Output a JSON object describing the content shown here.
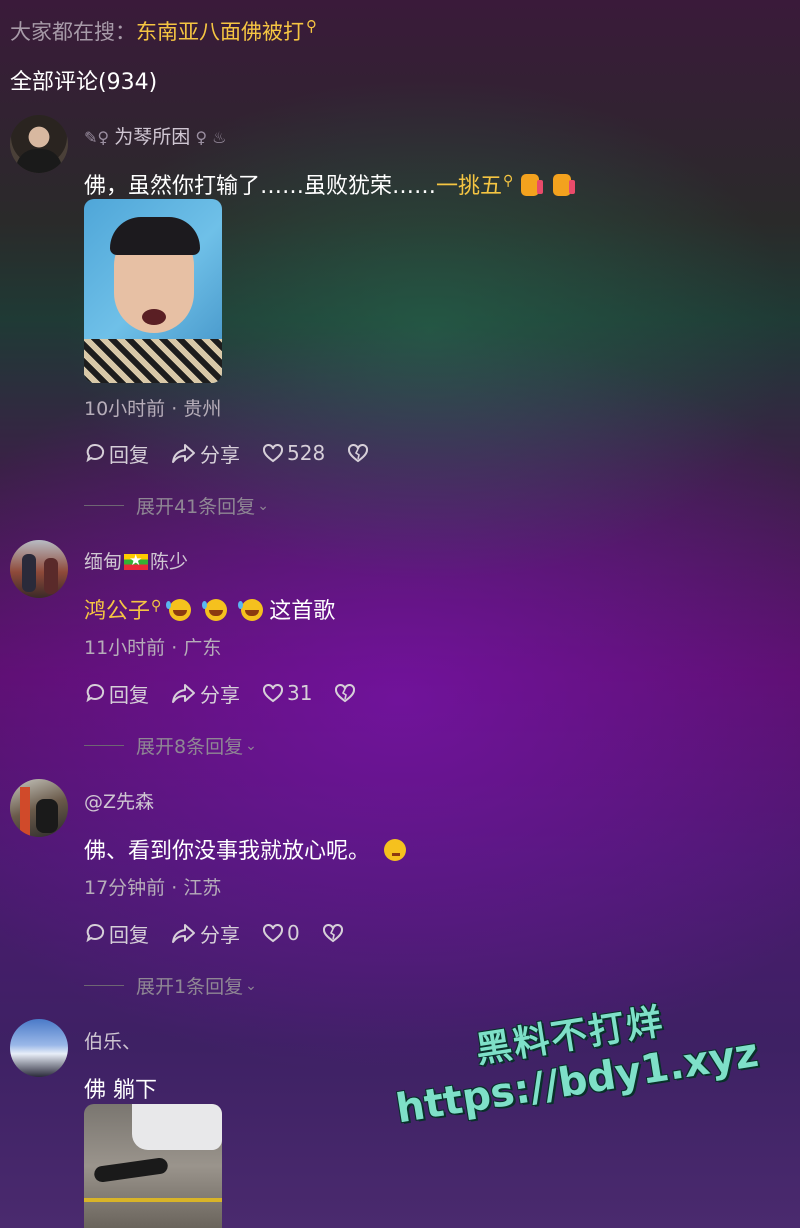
{
  "search_hint": {
    "label": "大家都在搜：",
    "keyword": "东南亚八面佛被打"
  },
  "comments_title": "全部评论(934)",
  "comments": [
    {
      "username": "为琴所困",
      "text": "佛，虽然你打输了……虽败犹荣……",
      "link_text": "一挑五",
      "emojis": [
        "thumbs-up",
        "thumbs-up"
      ],
      "time": "10小时前",
      "location": "贵州",
      "reply_label": "回复",
      "share_label": "分享",
      "likes": "528",
      "expand_label": "展开41条回复"
    },
    {
      "username_prefix": "缅甸",
      "username": "陈少",
      "link_text": "鸿公子",
      "emojis": [
        "laughing",
        "laughing",
        "laughing"
      ],
      "text": "这首歌",
      "time": "11小时前",
      "location": "广东",
      "reply_label": "回复",
      "share_label": "分享",
      "likes": "31",
      "expand_label": "展开8条回复"
    },
    {
      "username": "@Z先森",
      "text": "佛、看到你没事我就放心呢。",
      "emojis": [
        "thinking"
      ],
      "time": "17分钟前",
      "location": "江苏",
      "reply_label": "回复",
      "share_label": "分享",
      "likes": "0",
      "expand_label": "展开1条回复"
    },
    {
      "username": "伯乐、",
      "text": "佛 躺下"
    }
  ],
  "watermark": {
    "line1": "黑料不打烊",
    "line2": "https://bdy1.xyz"
  },
  "colors": {
    "highlight": "#f5c542",
    "watermark": "#7ee0c8"
  }
}
